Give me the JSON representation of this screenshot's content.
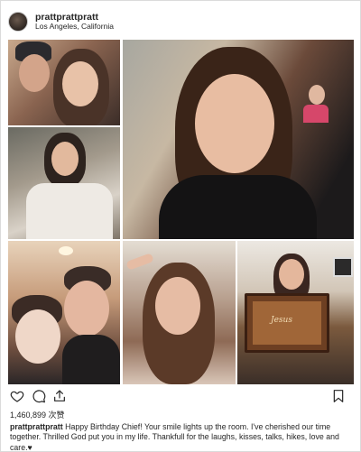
{
  "post": {
    "username": "prattprattpratt",
    "location": "Los Angeles, California",
    "likes": "1,460,899 次赞",
    "caption_user": "prattprattpratt",
    "caption_text": "Happy Birthday Chief! Your smile lights up the room. I've cherished our time together. Thrilled God put you in my life. Thankfull for the laughs, kisses, talks, hikes, love and care.♥",
    "sign_text": "Jesus"
  },
  "icons": {
    "like": "heart-icon",
    "comment": "comment-icon",
    "share": "share-icon",
    "save": "bookmark-icon"
  }
}
